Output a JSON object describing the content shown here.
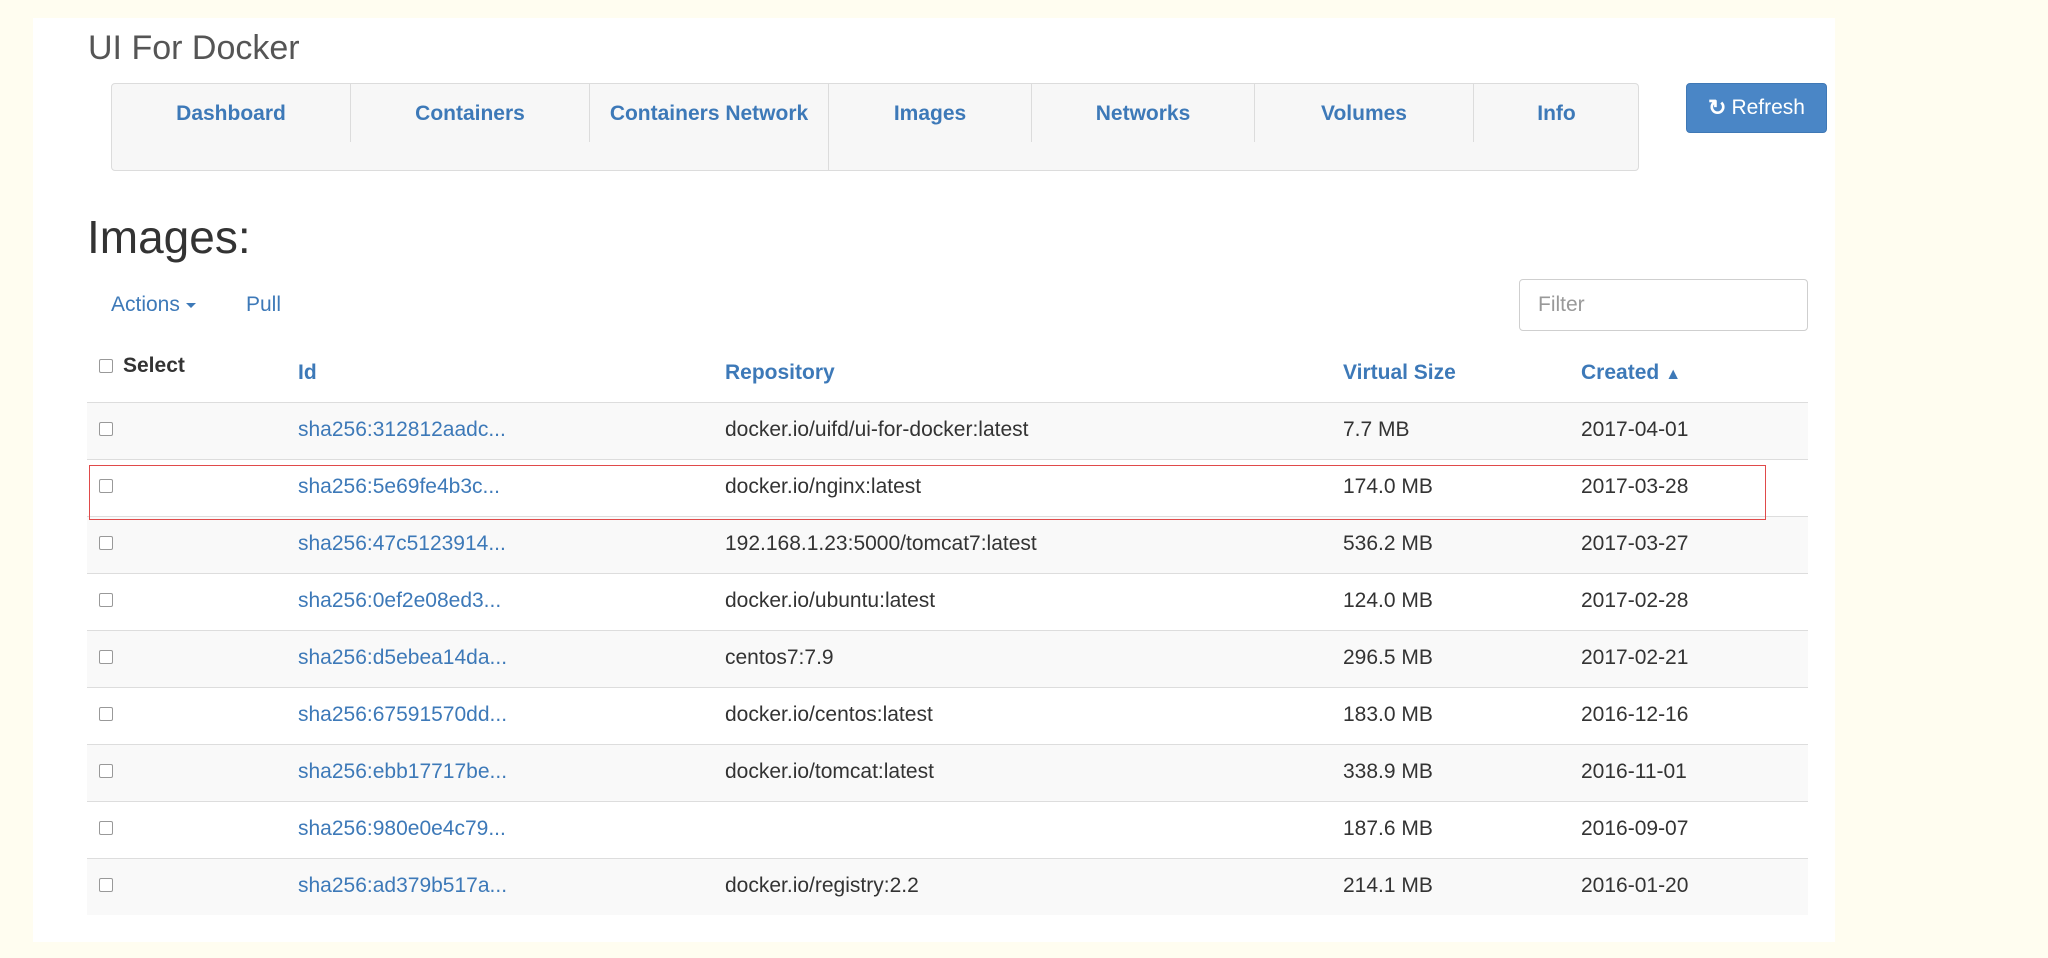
{
  "app": {
    "title": "UI For Docker"
  },
  "nav": {
    "items": [
      {
        "label": "Dashboard"
      },
      {
        "label": "Containers"
      },
      {
        "label": "Containers Network"
      },
      {
        "label": "Images"
      },
      {
        "label": "Networks"
      },
      {
        "label": "Volumes"
      },
      {
        "label": "Info"
      }
    ],
    "refresh_label": "Refresh"
  },
  "page": {
    "heading": "Images:",
    "actions_label": "Actions",
    "pull_label": "Pull",
    "filter_placeholder": "Filter"
  },
  "table": {
    "headers": {
      "select": "Select",
      "id": "Id",
      "repository": "Repository",
      "virtual_size": "Virtual Size",
      "created": "Created"
    },
    "rows": [
      {
        "id": "sha256:312812aadc...",
        "repository": "docker.io/uifd/ui-for-docker:latest",
        "size": "7.7 MB",
        "created": "2017-04-01"
      },
      {
        "id": "sha256:5e69fe4b3c...",
        "repository": "docker.io/nginx:latest",
        "size": "174.0 MB",
        "created": "2017-03-28"
      },
      {
        "id": "sha256:47c5123914...",
        "repository": "192.168.1.23:5000/tomcat7:latest",
        "size": "536.2 MB",
        "created": "2017-03-27"
      },
      {
        "id": "sha256:0ef2e08ed3...",
        "repository": "docker.io/ubuntu:latest",
        "size": "124.0 MB",
        "created": "2017-02-28"
      },
      {
        "id": "sha256:d5ebea14da...",
        "repository": "centos7:7.9",
        "size": "296.5 MB",
        "created": "2017-02-21"
      },
      {
        "id": "sha256:67591570dd...",
        "repository": "docker.io/centos:latest",
        "size": "183.0 MB",
        "created": "2016-12-16"
      },
      {
        "id": "sha256:ebb17717be...",
        "repository": "docker.io/tomcat:latest",
        "size": "338.9 MB",
        "created": "2016-11-01"
      },
      {
        "id": "sha256:980e0e4c79...",
        "repository": "",
        "size": "187.6 MB",
        "created": "2016-09-07"
      },
      {
        "id": "sha256:ad379b517a...",
        "repository": "docker.io/registry:2.2",
        "size": "214.1 MB",
        "created": "2016-01-20"
      }
    ]
  },
  "colors": {
    "link": "#3d79b8",
    "refresh_button": "#4a86c6",
    "highlight_border": "#e04a4a",
    "background": "#fffdf0"
  },
  "icons": {
    "refresh": "refresh-icon",
    "sort": "chevron-up-icon",
    "actions_caret": "caret-down-icon"
  }
}
